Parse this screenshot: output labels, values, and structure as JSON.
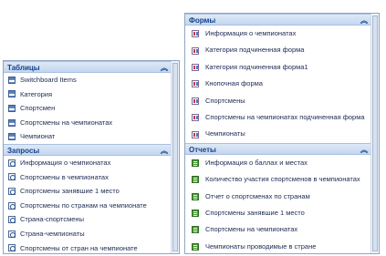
{
  "left_pane": {
    "groups": [
      {
        "title": "Таблицы",
        "collapse_glyph": "︽",
        "items": [
          {
            "label": "Switchboard Items",
            "icon": "table-icon"
          },
          {
            "label": "Категория",
            "icon": "table-icon"
          },
          {
            "label": "Спортсмен",
            "icon": "table-icon"
          },
          {
            "label": "Спортсмены на чемпионатах",
            "icon": "table-icon"
          },
          {
            "label": "Чемпионат",
            "icon": "table-icon"
          }
        ]
      },
      {
        "title": "Запросы",
        "collapse_glyph": "︽",
        "items": [
          {
            "label": "Информация о чемпионатах",
            "icon": "query-icon"
          },
          {
            "label": "Спортсмены в чемпионатах",
            "icon": "query-icon"
          },
          {
            "label": "Спортсмены занявшие 1 место",
            "icon": "query-icon"
          },
          {
            "label": "Спортсмены по странам на чемпионате",
            "icon": "query-icon"
          },
          {
            "label": "Страна-спортсмены",
            "icon": "query-icon"
          },
          {
            "label": "Страна-чемпионаты",
            "icon": "query-icon"
          },
          {
            "label": "Спортсмены от стран на чемпионате",
            "icon": "query-icon"
          }
        ]
      }
    ]
  },
  "right_pane": {
    "groups": [
      {
        "title": "Формы",
        "collapse_glyph": "︽",
        "items": [
          {
            "label": "Информация о чемпионатах",
            "icon": "form-icon"
          },
          {
            "label": "Категория подчиненная форма",
            "icon": "form-icon"
          },
          {
            "label": "Категория подчиненная форма1",
            "icon": "form-icon"
          },
          {
            "label": "Кнопочная форма",
            "icon": "form-icon"
          },
          {
            "label": "Спортсмены",
            "icon": "form-icon"
          },
          {
            "label": "Спортсмены на чемпионатах подчиненная форма",
            "icon": "form-icon"
          },
          {
            "label": "Чемпионаты",
            "icon": "form-icon"
          }
        ]
      },
      {
        "title": "Отчеты",
        "collapse_glyph": "︽",
        "items": [
          {
            "label": "Информация о баллах и местах",
            "icon": "report-icon"
          },
          {
            "label": "Количество участия спортсменов в чемпионатах",
            "icon": "report-icon"
          },
          {
            "label": "Отчет о спортсменах по странам",
            "icon": "report-icon"
          },
          {
            "label": "Спортсмены занявшие 1 место",
            "icon": "report-icon"
          },
          {
            "label": "Спортсмены на чемпионатах",
            "icon": "report-icon"
          },
          {
            "label": "Чемпионаты проводимые в стране",
            "icon": "report-icon"
          }
        ]
      }
    ]
  }
}
